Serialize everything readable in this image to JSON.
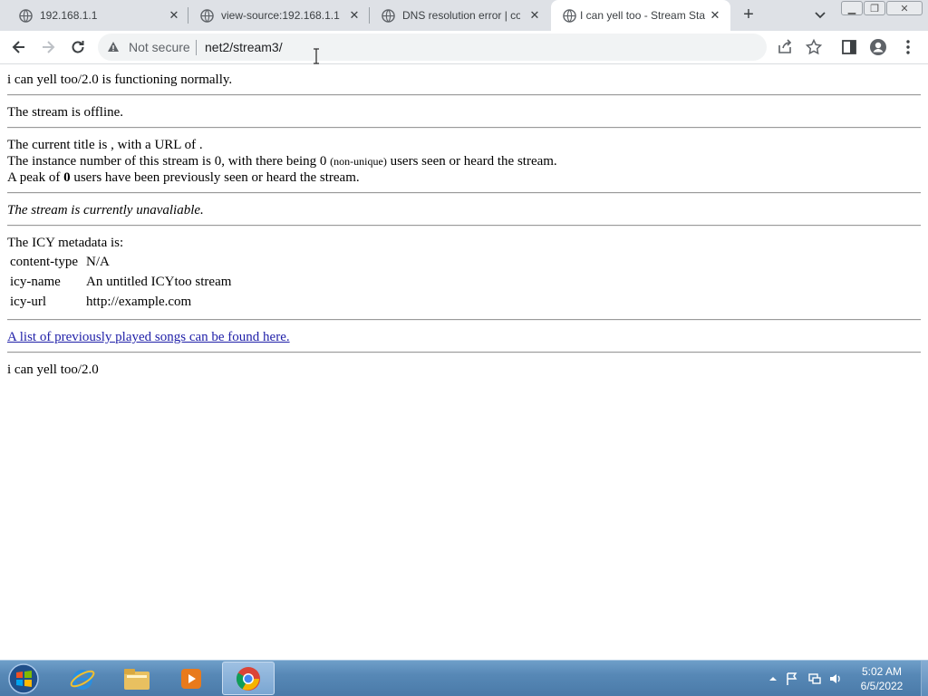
{
  "browser": {
    "tabs": [
      {
        "title": "192.168.1.1"
      },
      {
        "title": "view-source:192.168.1.1"
      },
      {
        "title": "DNS resolution error | co"
      },
      {
        "title": "I can yell too - Stream Sta"
      }
    ],
    "new_tab_label": "+",
    "address": {
      "security_label": "Not secure",
      "url": "net2/stream3/"
    }
  },
  "page": {
    "status_line": "i can yell too/2.0 is functioning normally.",
    "stream_status": "The stream is offline.",
    "title_line": "The current title is , with a URL of .",
    "instance_line_prefix": "The instance number of this stream is 0, with there being 0",
    "instance_line_small": "(non-unique)",
    "instance_line_suffix": "users seen or heard the stream.",
    "peak_prefix": "A peak of",
    "peak_value": "0",
    "peak_suffix": "users have been previously seen or heard the stream.",
    "availability": "The stream is currently unavaliable.",
    "icy_heading": "The ICY metadata is:",
    "icy_metadata": [
      {
        "key": "content-type",
        "value": "N/A"
      },
      {
        "key": "icy-name",
        "value": "An untitled ICYtoo stream"
      },
      {
        "key": "icy-url",
        "value": "http://example.com"
      }
    ],
    "history_link": "A list of previously played songs can be found here.",
    "footer": "i can yell too/2.0"
  },
  "taskbar": {
    "time": "5:02 AM",
    "date": "6/5/2022"
  }
}
